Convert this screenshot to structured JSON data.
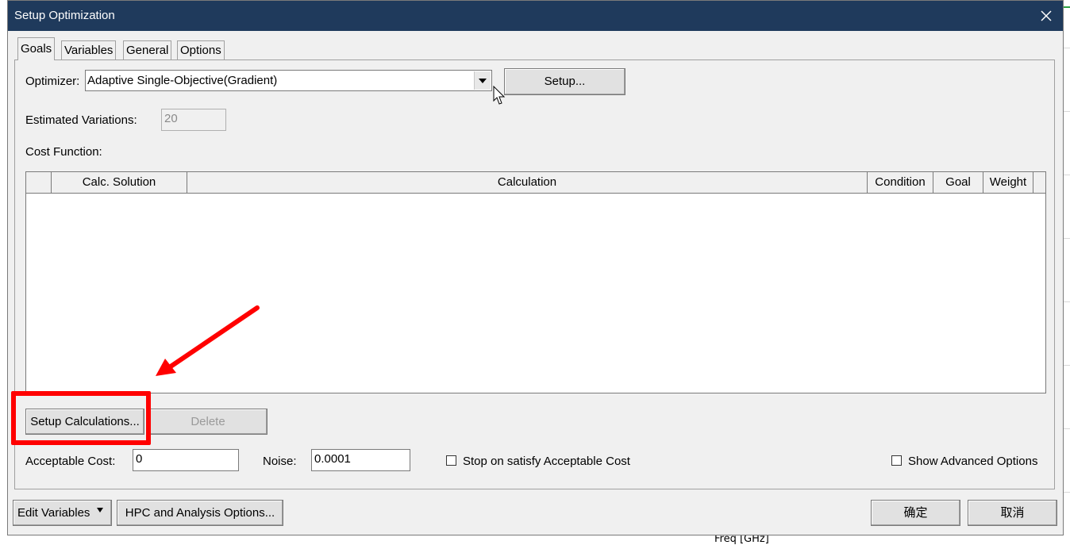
{
  "background": {
    "axis_label": "Freq [GHz]"
  },
  "dialog": {
    "title": "Setup Optimization",
    "tabs": [
      "Goals",
      "Variables",
      "General",
      "Options"
    ],
    "active_tab": "Goals",
    "optimizer_label": "Optimizer:",
    "optimizer_value": "Adaptive Single-Objective(Gradient)",
    "setup_button": "Setup...",
    "estimated_variations_label": "Estimated Variations:",
    "estimated_variations_value": "20",
    "cost_function_label": "Cost Function:",
    "table": {
      "columns": [
        "",
        "Calc. Solution",
        "Calculation",
        "Condition",
        "Goal",
        "Weight"
      ],
      "rows": []
    },
    "setup_calculations_button": "Setup Calculations...",
    "delete_button": "Delete",
    "acceptable_cost_label": "Acceptable Cost:",
    "acceptable_cost_value": "0",
    "noise_label": "Noise:",
    "noise_value": "0.0001",
    "stop_on_satisfy_label": "Stop on satisfy Acceptable Cost",
    "stop_on_satisfy_checked": false,
    "show_advanced_label": "Show Advanced Options",
    "show_advanced_checked": false,
    "edit_variables_button": "Edit Variables",
    "hpc_button": "HPC and Analysis Options...",
    "ok_button": "确定",
    "cancel_button": "取消"
  },
  "colors": {
    "titlebar": "#1f3a5c",
    "annotation": "#ff0000",
    "dialog_bg": "#f0f0f0"
  }
}
